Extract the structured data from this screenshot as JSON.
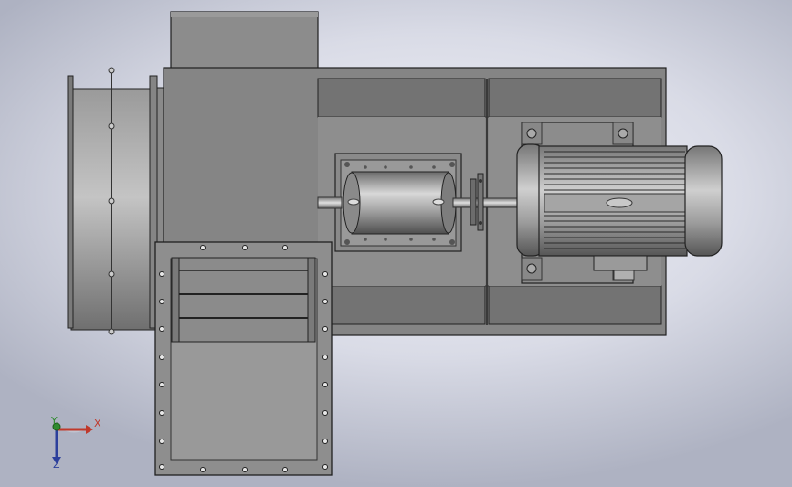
{
  "viewport": {
    "background_center": "#f4f5fa",
    "background_edge": "#aeb2c2",
    "colors": {
      "housing": "#8c8c8c",
      "frame": "#7a7a7a",
      "outline": "#1f1f1f",
      "motor_body": "#9a9a9a",
      "axis_x": "#c0392b",
      "axis_y": "#2e8b2e",
      "axis_z": "#2c3f9c"
    }
  },
  "triad": {
    "x_label": "X",
    "y_label": "Y",
    "z_label": "Z"
  }
}
